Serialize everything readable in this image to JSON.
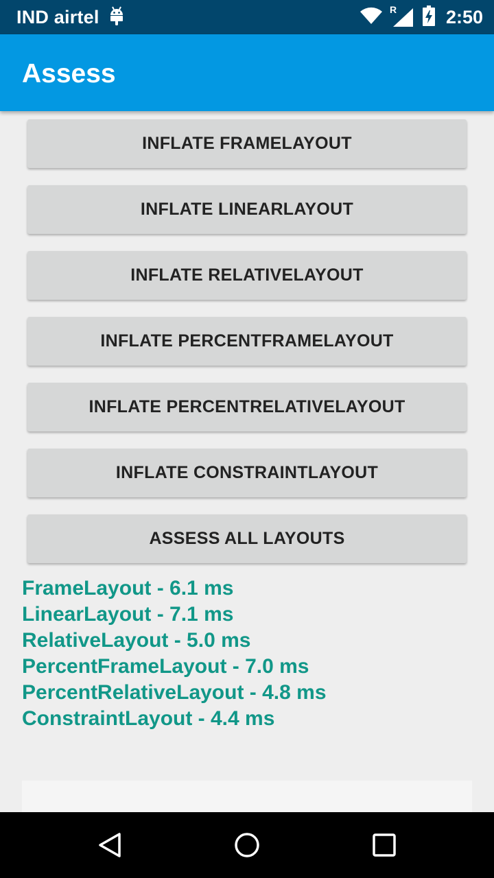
{
  "status_bar": {
    "carrier": "IND airtel",
    "roaming_indicator": "R",
    "time": "2:50",
    "icons": [
      "android-debug-icon",
      "wifi-icon",
      "cell-signal-icon",
      "battery-charging-icon"
    ]
  },
  "app_bar": {
    "title": "Assess"
  },
  "buttons": [
    {
      "label": "INFLATE FRAMELAYOUT"
    },
    {
      "label": "INFLATE LINEARLAYOUT"
    },
    {
      "label": "INFLATE RELATIVELAYOUT"
    },
    {
      "label": "INFLATE PERCENTFRAMELAYOUT"
    },
    {
      "label": "INFLATE PERCENTRELATIVELAYOUT"
    },
    {
      "label": "INFLATE CONSTRAINTLAYOUT"
    },
    {
      "label": "ASSESS ALL LAYOUTS"
    }
  ],
  "results": [
    "FrameLayout - 6.1 ms",
    "LinearLayout - 7.1 ms",
    "RelativeLayout - 5.0 ms",
    "PercentFrameLayout - 7.0 ms",
    "PercentRelativeLayout - 4.8 ms",
    "ConstraintLayout - 4.4 ms"
  ],
  "nav_bar": {
    "icons": [
      "back-icon",
      "home-icon",
      "recents-icon"
    ]
  },
  "colors": {
    "status_bar": "#02466c",
    "app_bar": "#0398e2",
    "button_bg": "#d6d7d7",
    "result_text": "#119788",
    "background": "#eeeeee"
  }
}
